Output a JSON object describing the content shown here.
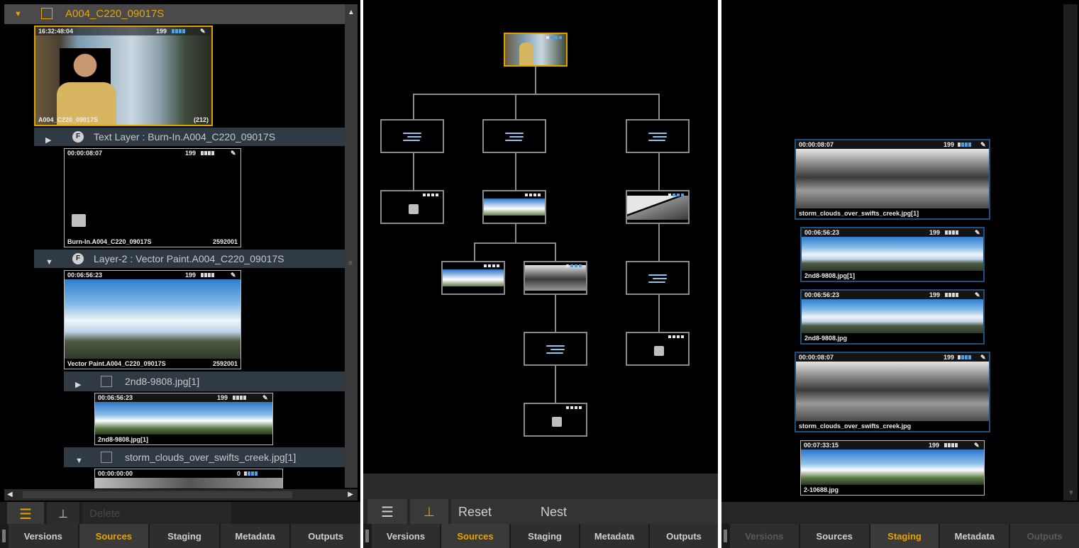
{
  "colors": {
    "accent": "#e8a400",
    "selection_border": "#e0a000",
    "blue_border": "#1f4f7a",
    "background": "#000000"
  },
  "left_panel": {
    "header_title": "A004_C220_09017S",
    "main_clip": {
      "timecode": "16:32:48:04",
      "frames": "199",
      "caption": "A004_C220_09017S",
      "count": "(212)"
    },
    "layer1": {
      "label": "Text Layer : Burn-In.A004_C220_09017S",
      "badge": "F",
      "thumb": {
        "timecode": "00:00:08:07",
        "frames": "199",
        "caption": "Burn-In.A004_C220_09017S",
        "count": "2592001"
      }
    },
    "layer2": {
      "label": "Layer-2 : Vector Paint.A004_C220_09017S",
      "badge": "F",
      "thumb": {
        "timecode": "00:06:56:23",
        "frames": "199",
        "caption": "Vector Paint.A004_C220_09017S",
        "count": "2592001"
      }
    },
    "item_2nd8": {
      "label": "2nd8-9808.jpg[1]",
      "thumb": {
        "timecode": "00:06:56:23",
        "frames": "199",
        "caption": "2nd8-9808.jpg[1]"
      }
    },
    "item_storm": {
      "label": "storm_clouds_over_swifts_creek.jpg[1]",
      "thumb": {
        "timecode": "00:00:00:00",
        "frames": "0"
      }
    },
    "toolbar": {
      "delete_label": "Delete"
    },
    "tabs": [
      "Versions",
      "Sources",
      "Staging",
      "Metadata",
      "Outputs"
    ],
    "active_tab": "Sources"
  },
  "middle_panel": {
    "toolbar": {
      "reset_label": "Reset",
      "nest_label": "Nest"
    },
    "tabs": [
      "Versions",
      "Sources",
      "Staging",
      "Metadata",
      "Outputs"
    ],
    "active_tab": "Sources"
  },
  "right_panel": {
    "thumbs": [
      {
        "timecode": "00:00:08:07",
        "frames": "199",
        "caption": "storm_clouds_over_swifts_creek.jpg[1]"
      },
      {
        "timecode": "00:06:56:23",
        "frames": "199",
        "caption": "2nd8-9808.jpg[1]"
      },
      {
        "timecode": "00:06:56:23",
        "frames": "199",
        "caption": "2nd8-9808.jpg"
      },
      {
        "timecode": "00:00:08:07",
        "frames": "199",
        "caption": "storm_clouds_over_swifts_creek.jpg"
      },
      {
        "timecode": "00:07:33:15",
        "frames": "199",
        "caption": "2-10688.jpg"
      }
    ],
    "tabs": [
      "Versions",
      "Sources",
      "Staging",
      "Metadata",
      "Outputs"
    ],
    "active_tab": "Staging"
  }
}
